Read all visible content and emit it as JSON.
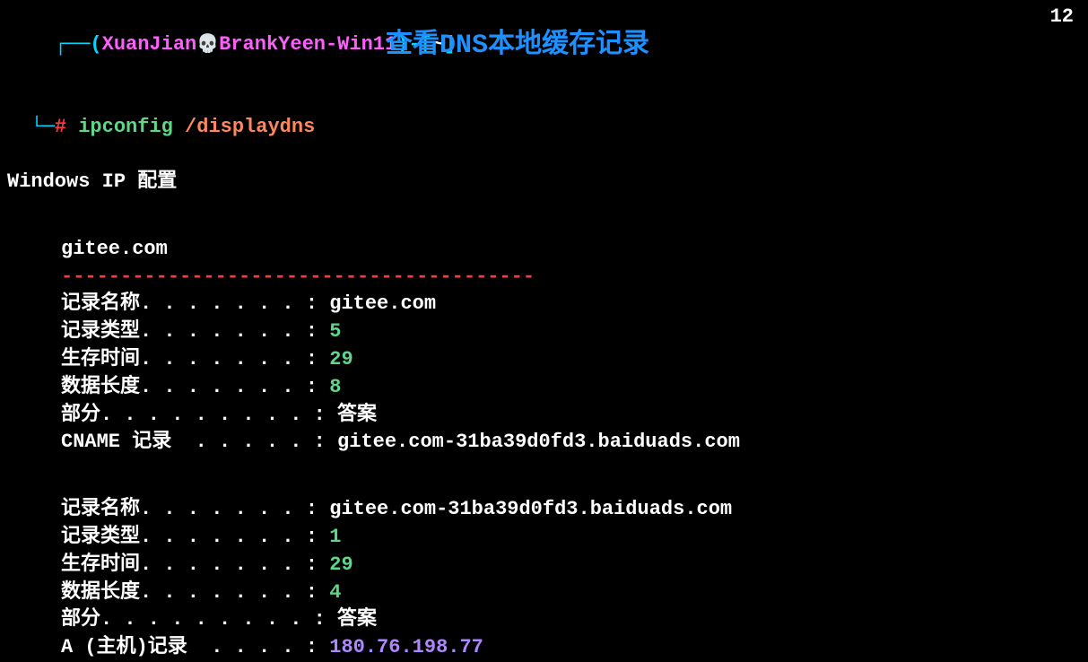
{
  "topRight": "12",
  "prompt": {
    "openBracket": "┌──(",
    "user": "XuanJian",
    "skull": "💀",
    "host": "BrankYeen-Win11",
    "closeBracket": ")-[",
    "path": "~",
    "endBracket": "]",
    "line2Lead": "└─",
    "hash": "#",
    "cmd1": "ipconfig",
    "cmd2": "/displaydns"
  },
  "annotation": "查看DNS本地缓存记录",
  "heading": "Windows IP 配置",
  "section": {
    "domain": "gitee.com",
    "divider": "----------------------------------------"
  },
  "labels": {
    "recordName": "记录名称. . . . . . . :",
    "recordType": "记录类型. . . . . . . :",
    "ttl": "生存时间. . . . . . . :",
    "dataLen": "数据长度. . . . . . . :",
    "section": "部分. . . . . . . . . :",
    "cname": "CNAME 记录  . . . . . :",
    "aRecord": "A (主机)记录  . . . . :"
  },
  "rec1": {
    "name": "gitee.com",
    "type": "5",
    "ttl": "29",
    "len": "8",
    "section": "答案",
    "cname": "gitee.com-31ba39d0fd3.baiduads.com"
  },
  "rec2": {
    "name": "gitee.com-31ba39d0fd3.baiduads.com",
    "type": "1",
    "ttl": "29",
    "len": "4",
    "section": "答案",
    "ip": "180.76.198.77"
  }
}
